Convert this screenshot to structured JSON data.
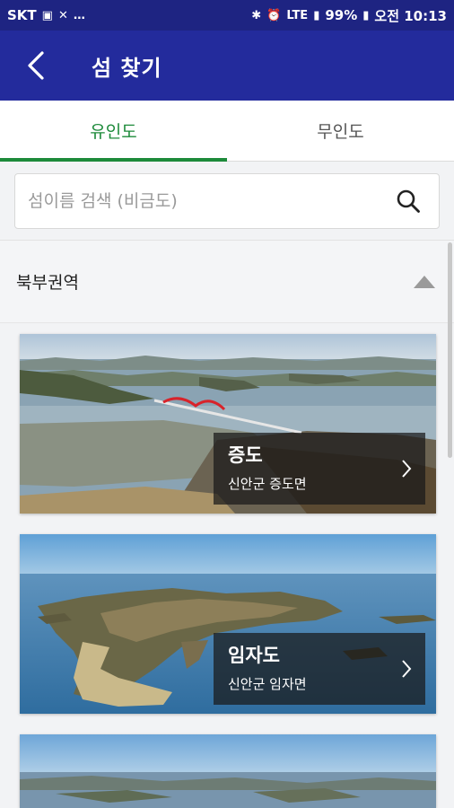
{
  "status_bar": {
    "carrier": "SKT",
    "network": "LTE",
    "battery": "99%",
    "time": "오전 10:13"
  },
  "app_bar": {
    "title": "섬 찾기"
  },
  "tabs": [
    {
      "label": "유인도",
      "active": true
    },
    {
      "label": "무인도",
      "active": false
    }
  ],
  "search": {
    "placeholder": "섬이름 검색 (비금도)",
    "value": ""
  },
  "section": {
    "title": "북부권역",
    "expanded": true
  },
  "islands": [
    {
      "name": "증도",
      "region": "신안군 증도면"
    },
    {
      "name": "임자도",
      "region": "신안군 임자면"
    },
    {
      "name": "",
      "region": ""
    }
  ],
  "colors": {
    "status_bar": "#1e2482",
    "app_bar": "#232b9c",
    "tab_active": "#1d8a3a"
  }
}
